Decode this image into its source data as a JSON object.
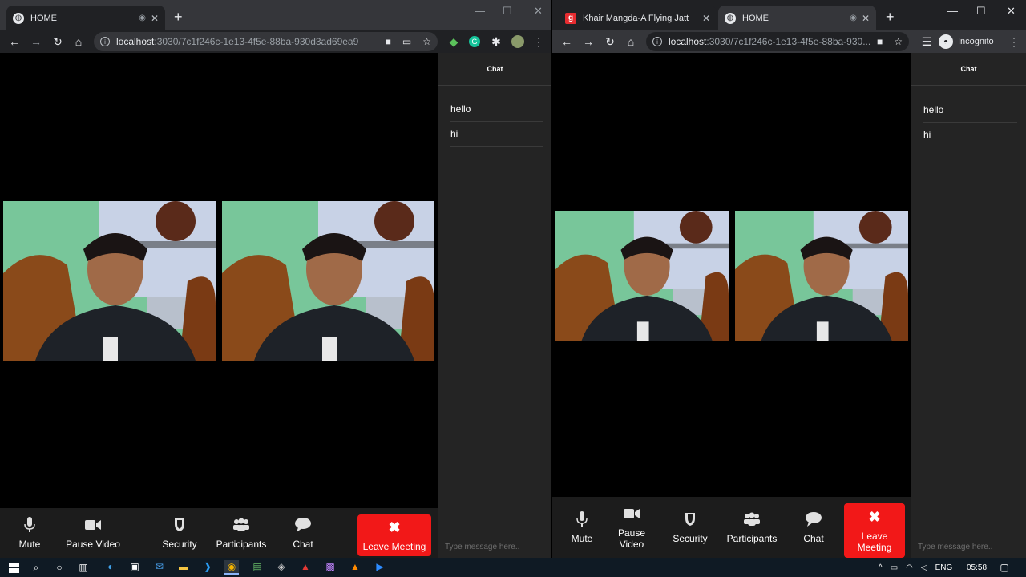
{
  "left_browser": {
    "tabs": [
      {
        "title": "HOME",
        "icon": "globe-icon"
      }
    ],
    "url_host": "localhost",
    "url_path": ":3030/7c1f246c-1e13-4f5e-88ba-930d3ad69ea9",
    "chat": {
      "header": "Chat",
      "messages": [
        "hello",
        "hi"
      ],
      "input_placeholder": "Type message here.."
    },
    "controls": {
      "mute": "Mute",
      "pause_video": "Pause Video",
      "security": "Security",
      "participants": "Participants",
      "chat": "Chat",
      "leave": "Leave Meeting"
    }
  },
  "right_browser": {
    "tabs": [
      {
        "title": "Khair Mangda-A Flying Jatt",
        "icon": "gaana-icon"
      },
      {
        "title": "HOME",
        "icon": "globe-icon"
      }
    ],
    "url_host": "localhost",
    "url_path": ":3030/7c1f246c-1e13-4f5e-88ba-930...",
    "profile_label": "Incognito",
    "chat": {
      "header": "Chat",
      "messages": [
        "hello",
        "hi"
      ],
      "input_placeholder": "Type message here.."
    },
    "controls": {
      "mute": "Mute",
      "pause_video_l1": "Pause",
      "pause_video_l2": "Video",
      "security": "Security",
      "participants": "Participants",
      "chat": "Chat",
      "leave_l1": "Leave",
      "leave_l2": "Meeting"
    }
  },
  "taskbar": {
    "language": "ENG",
    "time": "05:58"
  },
  "colors": {
    "leave_button": "#f21818",
    "chrome_dark": "#202124",
    "chrome_tab": "#35363a"
  }
}
